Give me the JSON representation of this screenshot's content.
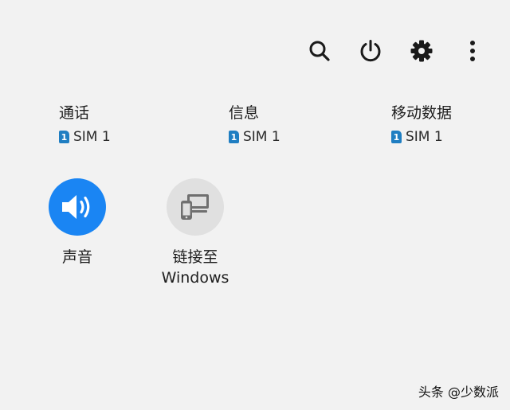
{
  "toolbar": {
    "search_icon": "search-icon",
    "power_icon": "power-icon",
    "settings_icon": "gear-icon",
    "more_icon": "more-vertical-icon"
  },
  "sim_shortcuts": [
    {
      "title": "通话",
      "sim_badge": "1",
      "sim_label": "SIM 1"
    },
    {
      "title": "信息",
      "sim_badge": "1",
      "sim_label": "SIM 1"
    },
    {
      "title": "移动数据",
      "sim_badge": "1",
      "sim_label": "SIM 1"
    }
  ],
  "tiles": {
    "sound": {
      "label": "声音",
      "active": true,
      "icon": "volume-icon"
    },
    "link_to_windows": {
      "label_line1": "链接至",
      "label_line2": "Windows",
      "active": false,
      "icon": "link-to-windows-icon"
    }
  },
  "watermark": {
    "text": "头条 @少数派"
  },
  "colors": {
    "background": "#f2f2f2",
    "accent_blue": "#1a85f3",
    "sim_badge": "#1f7ec2",
    "inactive_tile": "#e0e0e0",
    "icon_dark": "#1a1a1a"
  }
}
